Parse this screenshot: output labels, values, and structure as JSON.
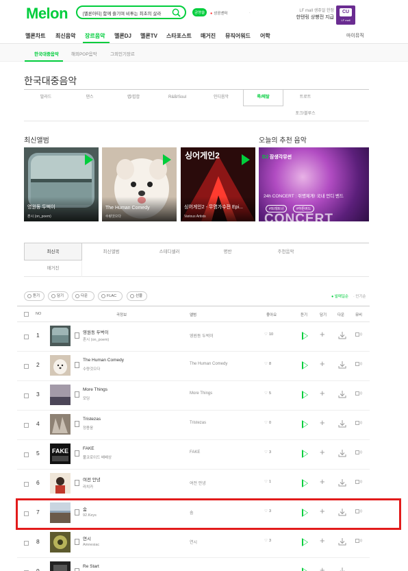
{
  "header": {
    "logo": "Melon",
    "search_text": "[멜론아티] 함께 즐기며 비투는 최초의 살라",
    "badge": "금영슬",
    "small_link": "상공센터",
    "ad_line1": "LF mall 생쥬얼 한정",
    "ad_line2": "한텐링 상빵전 지급",
    "ad_logo": "CU",
    "ad_logo_sub": "LF mall"
  },
  "main_nav": {
    "items": [
      "멜론차트",
      "최신음악",
      "장르음악",
      "멜론DJ",
      "멜론TV",
      "스타포스트",
      "매거진",
      "뮤직어워드",
      "어학"
    ],
    "my_music": "마이뮤직"
  },
  "sub_nav": {
    "items": [
      "한국대중음악",
      "해외POP음악",
      "그외인기장르"
    ]
  },
  "page_title": "한국대중음악",
  "genres": [
    "발라드",
    "댄스",
    "랩/힙합",
    "R&B/Soul",
    "인디음악",
    "록/메탈",
    "트로트",
    "포크/블루스"
  ],
  "sections": {
    "latest_album": "최신앨범",
    "today_recommend": "오늘의 추천 음악"
  },
  "albums": [
    {
      "title": "영원동 두벅이",
      "artist": "혼시 (on_poem)"
    },
    {
      "title": "The Human Comedy",
      "artist": "수량것으다"
    },
    {
      "title": "싱어게인2 - 무명가수전 Epi...",
      "artist": "Various Artists"
    }
  ],
  "dj_card": {
    "label_prefix": "DJ",
    "label": "잠생각뮤썬",
    "title": "24h CONCERT : 쥐명제게! 국내 언디 밴드",
    "tag1": "#트레트냐",
    "tag2": "#하튼버드",
    "big": "CONCERT"
  },
  "content_tabs": [
    "최신곡",
    "최신앨범",
    "스테디셀러",
    "명반",
    "주천음악",
    "매거진"
  ],
  "tool_buttons": [
    "듣기",
    "담기",
    "다운",
    "FLAC",
    "선물"
  ],
  "sort": {
    "on": "발매일순",
    "off": "인기순"
  },
  "table_headers": {
    "no": "NO",
    "song": "곡정보",
    "album": "앨범",
    "like": "좋아요",
    "play": "듣기",
    "add": "담기",
    "download": "다운",
    "mv": "뮤비"
  },
  "rows": [
    {
      "rank": "1",
      "song": "영원동 두벅이",
      "artist": "혼시 (on_poem)",
      "album": "영원동 두벅이",
      "likes": "10",
      "mv": "0"
    },
    {
      "rank": "2",
      "song": "The Human Comedy",
      "artist": "수량것으다",
      "album": "The Human Comedy",
      "likes": "8",
      "mv": "0"
    },
    {
      "rank": "3",
      "song": "More Things",
      "artist": "모딩",
      "album": "More Things",
      "likes": "5",
      "mv": "0"
    },
    {
      "rank": "4",
      "song": "Tristezas",
      "artist": "정용웅",
      "album": "Tristezas",
      "likes": "0",
      "mv": "0"
    },
    {
      "rank": "5",
      "song": "FAKE",
      "artist": "풀코로이드 배배상",
      "album": "FAKE",
      "likes": "3",
      "mv": "0"
    },
    {
      "rank": "6",
      "song": "여전 안녕",
      "artist": "라치카",
      "album": "여전 안녕",
      "likes": "1",
      "mv": "0"
    },
    {
      "rank": "7",
      "song": "숨",
      "artist": "92.Keys",
      "album": "숨",
      "likes": "3",
      "mv": "0"
    },
    {
      "rank": "8",
      "song": "연시",
      "artist": "Amnesiac",
      "album": "연시",
      "likes": "3",
      "mv": "0"
    },
    {
      "rank": "9",
      "song": "Re Start",
      "artist": "",
      "album": "",
      "likes": "",
      "mv": ""
    }
  ],
  "colors": {
    "brand": "#00cd3c",
    "highlight": "#e21b1b"
  }
}
